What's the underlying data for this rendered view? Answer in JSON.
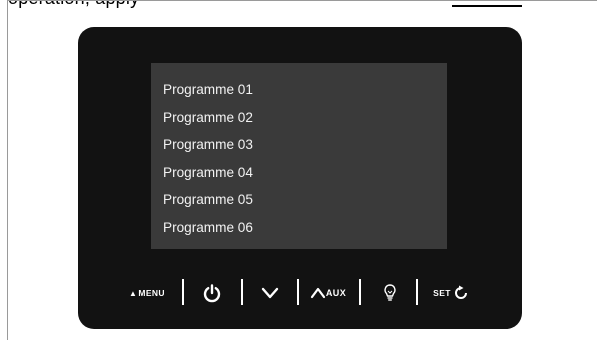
{
  "page": {
    "top_text_fragment": "operation, apply",
    "background": "#ffffff"
  },
  "device": {
    "body_color": "#121212",
    "screen_color": "#3a3a3a",
    "programmes": [
      "Programme 01",
      "Programme 02",
      "Programme 03",
      "Programme 04",
      "Programme 05",
      "Programme 06"
    ],
    "controls": {
      "menu_label": "MENU",
      "menu_icon": "eject-triangle-icon",
      "power_icon": "power-icon",
      "down_icon": "chevron-down-icon",
      "up_icon": "chevron-up-icon",
      "aux_label": "AUX",
      "light_icon": "lightbulb-icon",
      "set_label": "SET",
      "set_icon": "rotate-icon"
    }
  }
}
